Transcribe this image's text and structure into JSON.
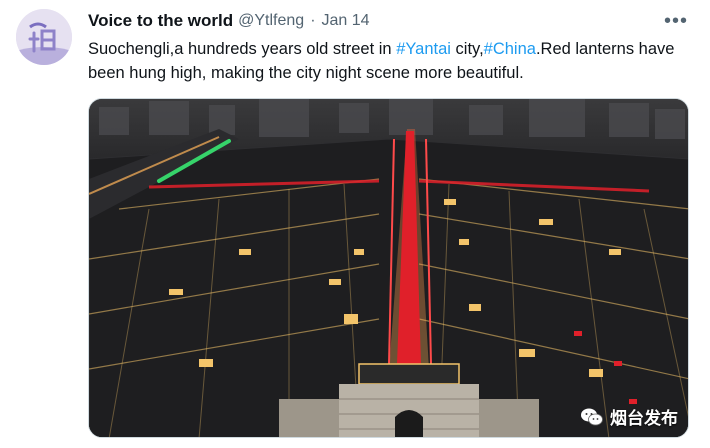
{
  "tweet": {
    "author_name": "Voice to the world",
    "handle": "@Ytlfeng",
    "separator": "·",
    "date": "Jan 14",
    "more_label": "•••",
    "text_segments": [
      {
        "text": "Suochengli,a hundreds years old street in ",
        "type": "text"
      },
      {
        "text": "#Yantai",
        "type": "hashtag"
      },
      {
        "text": " city,",
        "type": "text"
      },
      {
        "text": "#China",
        "type": "hashtag"
      },
      {
        "text": ".Red lanterns have been hung high, making the city night scene more beautiful.",
        "type": "text"
      }
    ],
    "media": {
      "watermark": "烟台发布",
      "watermark_icon": "wechat-icon"
    }
  },
  "colors": {
    "link": "#1d9bf0",
    "secondary_text": "#536471",
    "lantern_red": "#e0202a",
    "light_green": "#36d36a",
    "warm_light": "#f3c46a"
  }
}
